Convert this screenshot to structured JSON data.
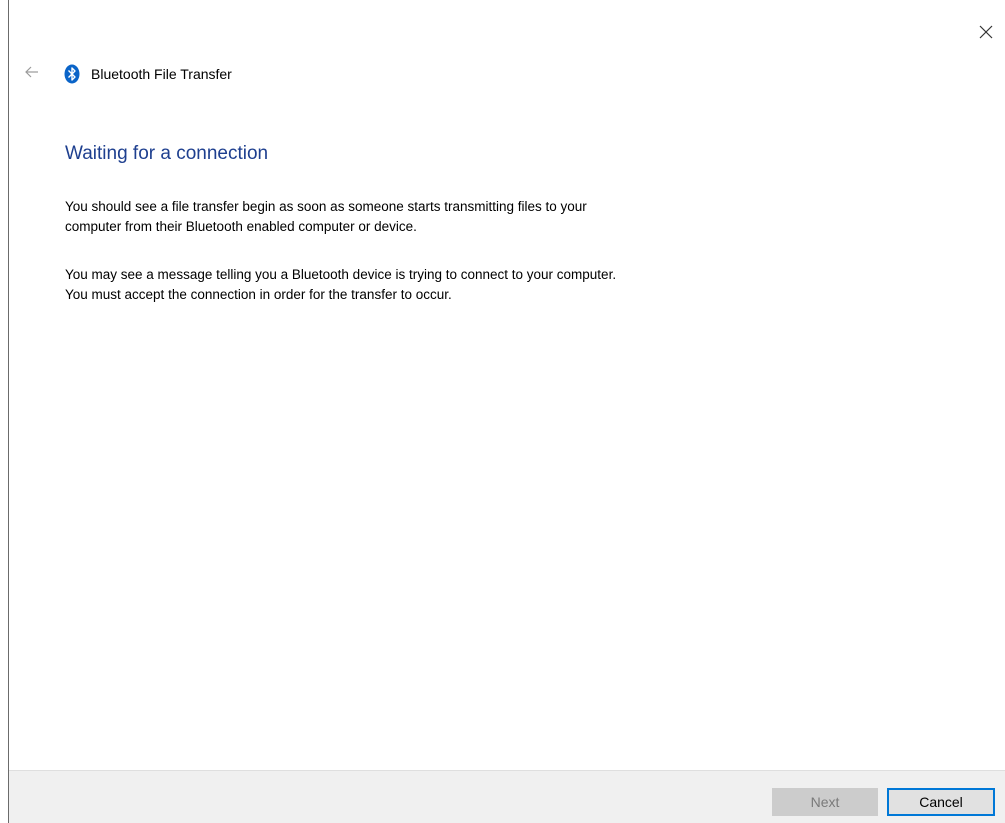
{
  "window": {
    "app_title": "Bluetooth File Transfer",
    "close_icon": "close-icon",
    "back_icon": "back-arrow-icon",
    "app_icon": "bluetooth-icon",
    "accent_color": "#0078d7",
    "heading_color": "#1e3f8f"
  },
  "main": {
    "heading": "Waiting for a connection",
    "paragraph1_line1": "You should see a file transfer begin as soon as someone starts transmitting files to your",
    "paragraph1_line2": "computer from their Bluetooth enabled computer or device.",
    "paragraph2_line1": "You may see a message telling you a Bluetooth device is trying to connect to your computer.",
    "paragraph2_line2": "You must accept the connection in order for the transfer to occur."
  },
  "footer": {
    "next_label": "Next",
    "next_enabled": false,
    "cancel_label": "Cancel"
  }
}
